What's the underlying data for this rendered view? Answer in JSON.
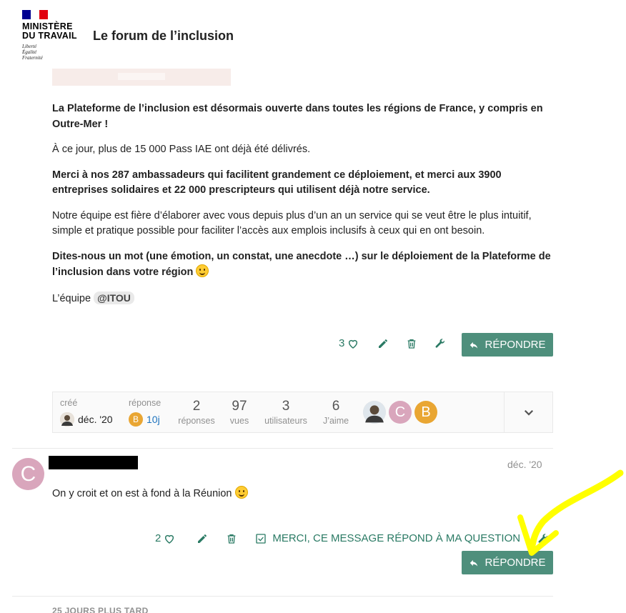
{
  "header": {
    "ministry_line1": "MINISTÈRE",
    "ministry_line2": "DU TRAVAIL",
    "motto1": "Liberté",
    "motto2": "Égalité",
    "motto3": "Fraternité",
    "site_title": "Le forum de l’inclusion"
  },
  "post": {
    "p1": "La Plateforme de l’inclusion est désormais ouverte dans toutes les régions de France, y compris en Outre-Mer !",
    "p2": "À ce jour, plus de 15 000 Pass IAE ont déjà été délivrés.",
    "p3": "Merci à nos 287 ambassadeurs qui facilitent grandement ce déploiement, et merci aux 3900 entreprises solidaires et 22 000 prescripteurs qui utilisent déjà notre service.",
    "p4": "Notre équipe est fière d’élaborer avec vous depuis plus d’un an un service qui se veut être le plus intuitif, simple et pratique possible pour faciliter l’accès aux emplois inclusifs à ceux qui en ont besoin.",
    "p5": "Dites-nous un mot (une émotion, un constat, une anecdote …) sur le déploiement de la Plateforme de l’inclusion dans votre région",
    "sign_prefix": "L’équipe",
    "mention": "@ITOU",
    "like_count": "3",
    "reply_label": "RÉPONDRE"
  },
  "topic_map": {
    "created_label": "créé",
    "created_date": "déc. '20",
    "reply_label": "réponse",
    "reply_avatar_letter": "B",
    "reply_age": "10j",
    "stats": [
      {
        "value": "2",
        "label": "réponses"
      },
      {
        "value": "97",
        "label": "vues"
      },
      {
        "value": "3",
        "label": "utilisateurs"
      },
      {
        "value": "6",
        "label": "J’aime"
      }
    ],
    "participant_letters": [
      "C",
      "B"
    ]
  },
  "reply": {
    "avatar_letter": "C",
    "date": "déc. '20",
    "text": "On y croit et on est à fond à la Réunion",
    "like_count": "2",
    "solution_label": "MERCI, CE MESSAGE RÉPOND À MA QUESTION",
    "reply_label": "RÉPONDRE"
  },
  "small_action": "25 JOURS PLUS TARD",
  "colors": {
    "accent": "#4e8f7c",
    "accent_text": "#2a7a64",
    "annotation": "#ffff00"
  }
}
